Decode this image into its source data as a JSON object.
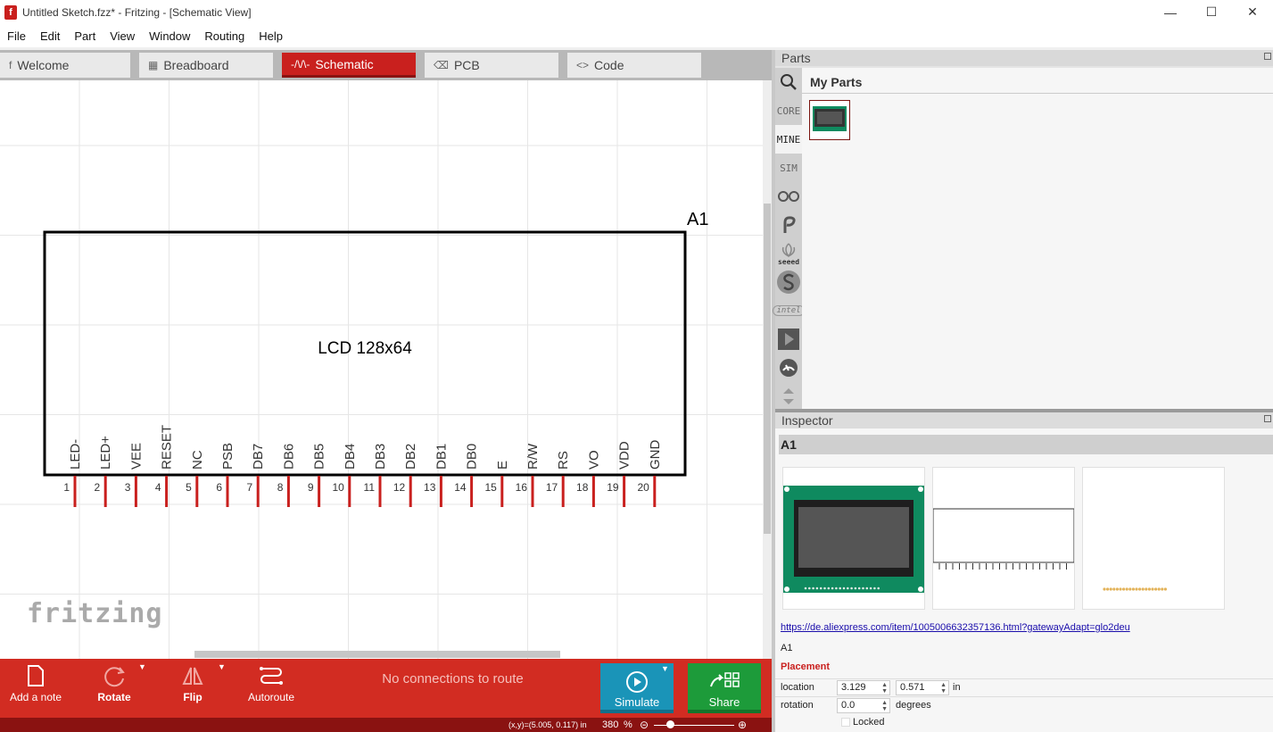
{
  "window": {
    "title": "Untitled Sketch.fzz* - Fritzing - [Schematic View]"
  },
  "menu": [
    "File",
    "Edit",
    "Part",
    "View",
    "Window",
    "Routing",
    "Help"
  ],
  "tabs": [
    {
      "label": "Welcome",
      "icon": "fritzing-f-icon"
    },
    {
      "label": "Breadboard",
      "icon": "breadboard-icon"
    },
    {
      "label": "Schematic",
      "icon": "resistor-icon",
      "active": true
    },
    {
      "label": "PCB",
      "icon": "pcb-icon"
    },
    {
      "label": "Code",
      "icon": "code-icon"
    }
  ],
  "schematic": {
    "ref": "A1",
    "part_name": "LCD 128x64",
    "pins": [
      {
        "num": "1",
        "name": "LED-"
      },
      {
        "num": "2",
        "name": "LED+"
      },
      {
        "num": "3",
        "name": "VEE"
      },
      {
        "num": "4",
        "name": "RESET"
      },
      {
        "num": "5",
        "name": "NC"
      },
      {
        "num": "6",
        "name": "PSB"
      },
      {
        "num": "7",
        "name": "DB7"
      },
      {
        "num": "8",
        "name": "DB6"
      },
      {
        "num": "9",
        "name": "DB5"
      },
      {
        "num": "10",
        "name": "DB4"
      },
      {
        "num": "11",
        "name": "DB3"
      },
      {
        "num": "12",
        "name": "DB2"
      },
      {
        "num": "13",
        "name": "DB1"
      },
      {
        "num": "14",
        "name": "DB0"
      },
      {
        "num": "15",
        "name": "E"
      },
      {
        "num": "16",
        "name": "R/W"
      },
      {
        "num": "17",
        "name": "RS"
      },
      {
        "num": "18",
        "name": "VO"
      },
      {
        "num": "19",
        "name": "VDD"
      },
      {
        "num": "20",
        "name": "GND"
      }
    ],
    "watermark": "fritzing"
  },
  "toolbar": {
    "add_note": "Add a note",
    "rotate": "Rotate",
    "flip": "Flip",
    "autoroute": "Autoroute",
    "routing_status": "No connections to route",
    "simulate": "Simulate",
    "share": "Share",
    "simulate_color": "#1a94b8",
    "share_color": "#1d9b3a"
  },
  "statusbar": {
    "coords": "(x,y)=(5.005, 0.117) in",
    "zoom": "380",
    "zoom_unit": "%"
  },
  "parts": {
    "header": "Parts",
    "bins": [
      "search-icon",
      "CORE",
      "MINE",
      "SIM",
      "arduino-icon",
      "fritzing-bin-icon",
      "seeed",
      "sparkfun-icon",
      "intel",
      "play-icon",
      "gauge-icon",
      "arrows-icon"
    ],
    "bin_labels": {
      "core": "CORE",
      "mine": "MINE",
      "sim": "SIM",
      "seeed": "seeed",
      "intel": "intel"
    },
    "active_bin": "MINE",
    "bin_title": "My Parts"
  },
  "inspector": {
    "header": "Inspector",
    "title": "A1",
    "link": "https://de.aliexpress.com/item/1005006632357136.html?gatewayAdapt=glo2deu",
    "label": "A1",
    "placement_label": "Placement",
    "location": {
      "label": "location",
      "x": "3.129",
      "y": "0.571",
      "unit": "in"
    },
    "rotation": {
      "label": "rotation",
      "value": "0.0",
      "unit": "degrees"
    },
    "locked": "Locked"
  },
  "colors": {
    "accent": "#c9201e",
    "pin": "#c9201e",
    "pcb_green": "#0f8a5f"
  }
}
